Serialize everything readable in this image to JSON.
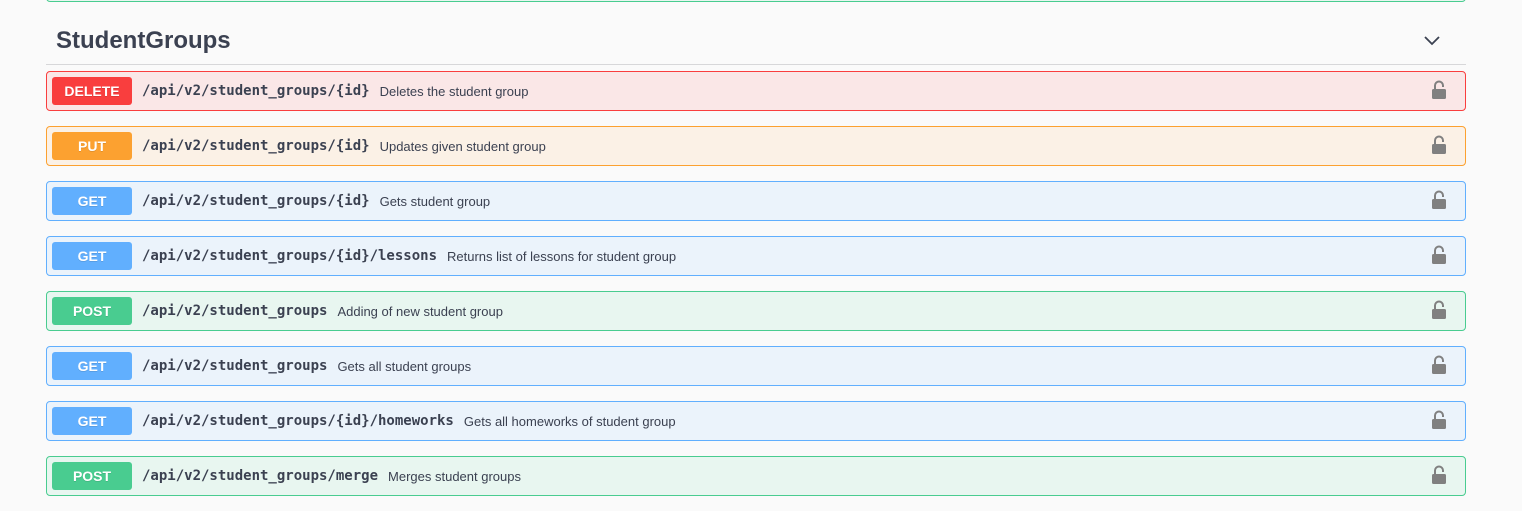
{
  "tag": {
    "title": "StudentGroups",
    "toggle_icon": "chevron-down-icon"
  },
  "operations": [
    {
      "method": "DELETE",
      "path": "/api/v2/student_groups/{id}",
      "summary": "Deletes the student group"
    },
    {
      "method": "PUT",
      "path": "/api/v2/student_groups/{id}",
      "summary": "Updates given student group"
    },
    {
      "method": "GET",
      "path": "/api/v2/student_groups/{id}",
      "summary": "Gets student group"
    },
    {
      "method": "GET",
      "path": "/api/v2/student_groups/{id}/lessons",
      "summary": "Returns list of lessons for student group"
    },
    {
      "method": "POST",
      "path": "/api/v2/student_groups",
      "summary": "Adding of new student group"
    },
    {
      "method": "GET",
      "path": "/api/v2/student_groups",
      "summary": "Gets all student groups"
    },
    {
      "method": "GET",
      "path": "/api/v2/student_groups/{id}/homeworks",
      "summary": "Gets all homeworks of student group"
    },
    {
      "method": "POST",
      "path": "/api/v2/student_groups/merge",
      "summary": "Merges student groups"
    }
  ],
  "colors": {
    "DELETE": {
      "badge": "#f93e3e",
      "border": "#f93e3e",
      "bg": "#fae7e7"
    },
    "PUT": {
      "badge": "#fca130",
      "border": "#fca130",
      "bg": "#fbf1e6"
    },
    "GET": {
      "badge": "#61affe",
      "border": "#61affe",
      "bg": "#ebf3fb"
    },
    "POST": {
      "badge": "#49cc90",
      "border": "#49cc90",
      "bg": "#e8f6f0"
    }
  },
  "icons": {
    "lock": "unlocked-padlock-icon"
  }
}
